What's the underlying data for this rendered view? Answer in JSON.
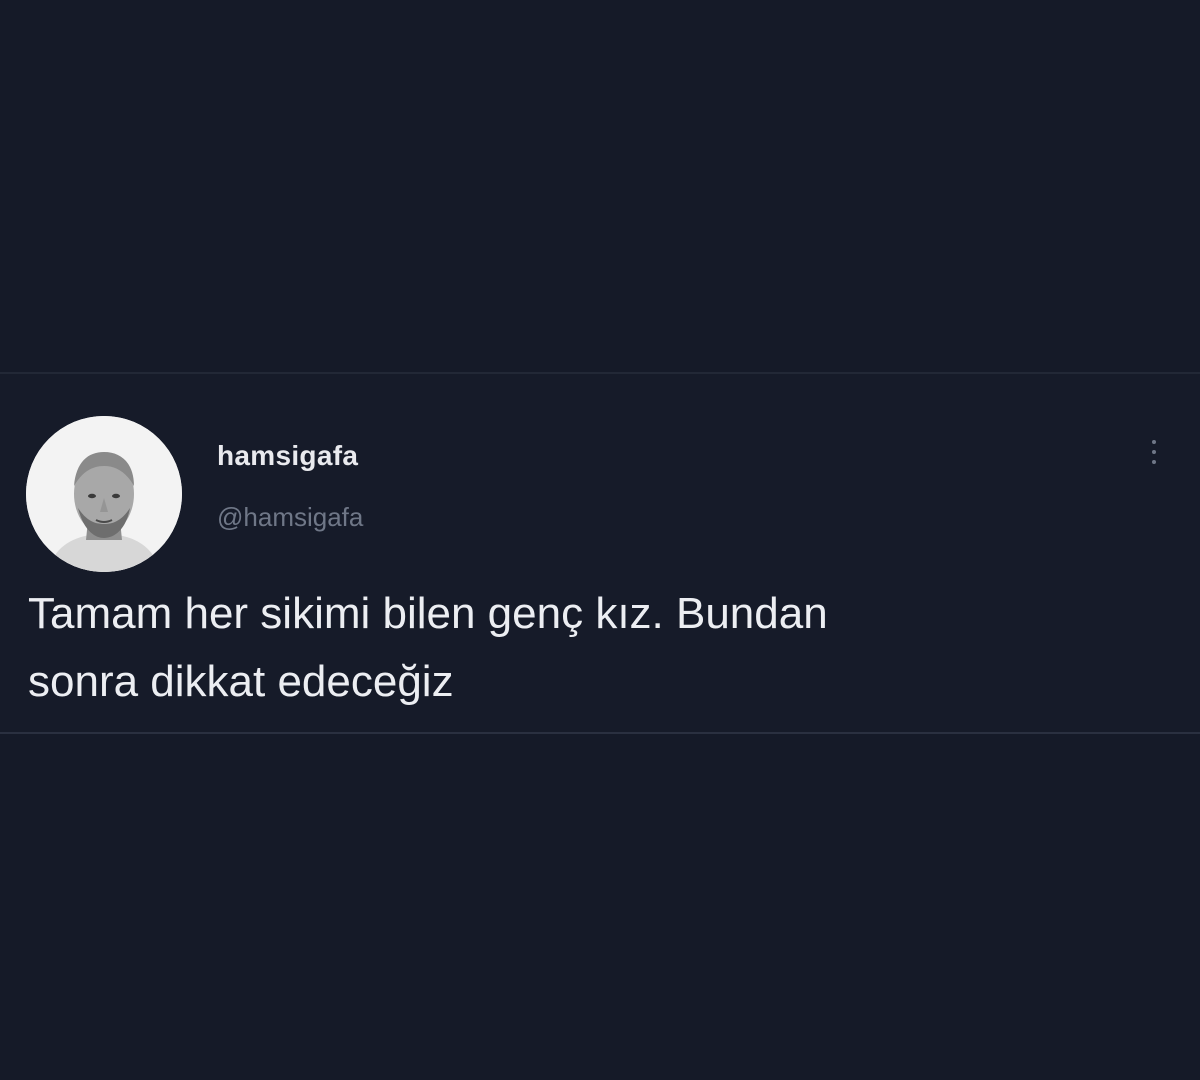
{
  "tweet": {
    "display_name": "hamsigafa",
    "handle": "@hamsigafa",
    "text": "Tamam her sikimi bilen genç kız. Bundan\nsonra dikkat edeceğiz",
    "avatar_icon": "profile-photo",
    "menu_icon": "more-vertical-icon"
  }
}
